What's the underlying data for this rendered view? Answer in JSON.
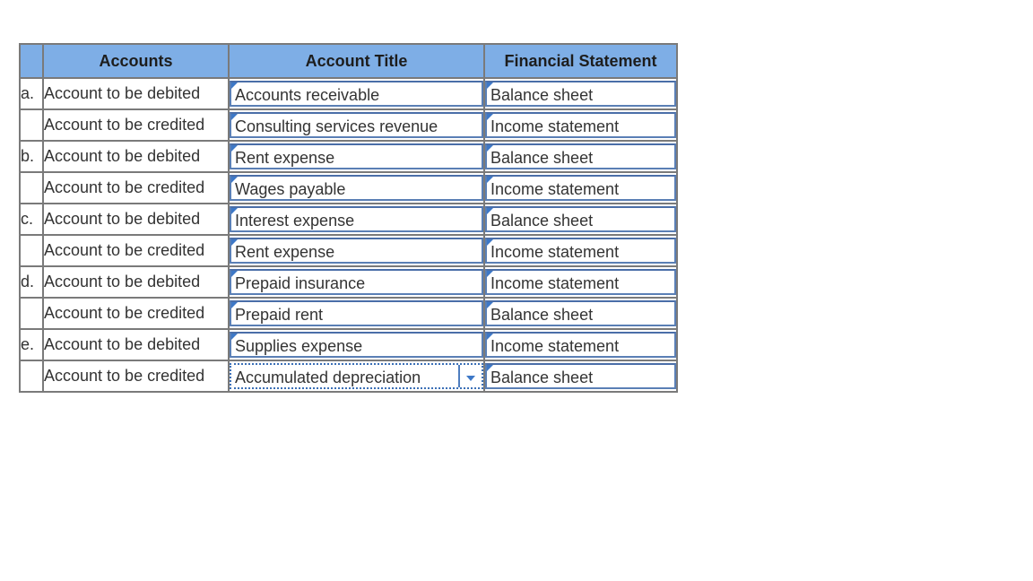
{
  "table": {
    "headers": {
      "letter": "",
      "accounts": "Accounts",
      "account_title": "Account Title",
      "financial_statement": "Financial Statement"
    },
    "rows": [
      {
        "letter": "a.",
        "account": "Account to be debited",
        "title": "Accounts receivable",
        "statement": "Balance sheet"
      },
      {
        "letter": "",
        "account": "Account to be credited",
        "title": "Consulting services revenue",
        "statement": "Income statement"
      },
      {
        "letter": "b.",
        "account": "Account to be debited",
        "title": "Rent expense",
        "statement": "Balance sheet"
      },
      {
        "letter": "",
        "account": "Account to be credited",
        "title": "Wages payable",
        "statement": "Income statement"
      },
      {
        "letter": "c.",
        "account": "Account to be debited",
        "title": "Interest expense",
        "statement": "Balance sheet"
      },
      {
        "letter": "",
        "account": "Account to be credited",
        "title": "Rent expense",
        "statement": "Income statement"
      },
      {
        "letter": "d.",
        "account": "Account to be debited",
        "title": "Prepaid insurance",
        "statement": "Income statement"
      },
      {
        "letter": "",
        "account": "Account to be credited",
        "title": "Prepaid rent",
        "statement": "Balance sheet"
      },
      {
        "letter": "e.",
        "account": "Account to be debited",
        "title": "Supplies expense",
        "statement": "Income statement"
      },
      {
        "letter": "",
        "account": "Account to be credited",
        "title": "Accumulated depreciation",
        "statement": "Balance sheet"
      }
    ],
    "active_row": 9,
    "icons": {
      "dropdown": "chevron-down-icon",
      "corner_marker": "corner-flag-icon"
    },
    "colors": {
      "header_bg": "#7eaee6",
      "grid_border": "#7a7a7a",
      "select_border": "#5a7fb5",
      "accent": "#3d78c7"
    }
  }
}
